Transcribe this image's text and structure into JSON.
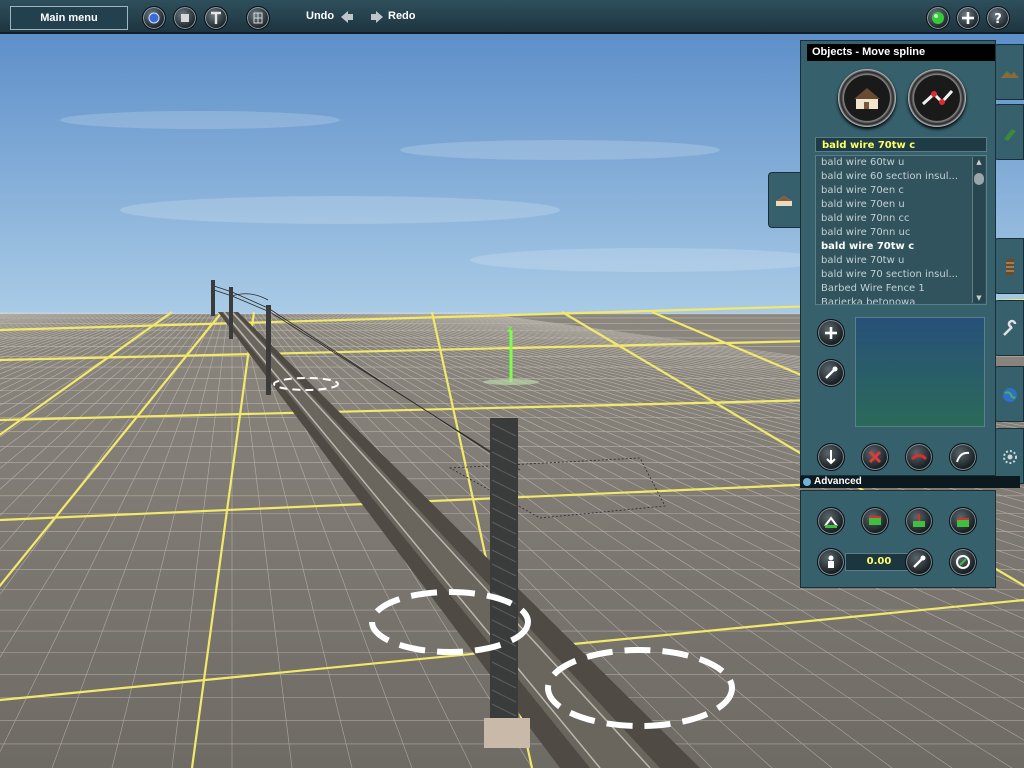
{
  "toolbar": {
    "main_menu_label": "Main menu",
    "undo_label": "Undo",
    "redo_label": "Redo",
    "icons": [
      "globe-icon",
      "stop-icon",
      "tools-icon",
      "grid-icon",
      "status-light-icon",
      "add-icon",
      "help-icon"
    ]
  },
  "objects_panel": {
    "title": "Objects - Move spline",
    "selected": "bald wire 70tw c",
    "list": [
      "bald wire 60tw u",
      "bald wire 60 section insul...",
      "bald wire 70en c",
      "bald wire 70en u",
      "bald wire 70nn cc",
      "bald wire 70nn uc",
      "bald wire 70tw c",
      "bald wire 70tw u",
      "bald wire 70 section insul...",
      "Barbed Wire Fence 1",
      "Barierka betonowa"
    ],
    "selected_index": 6
  },
  "advanced": {
    "label": "Advanced",
    "value": "0.00"
  },
  "colors": {
    "panel": "#35606c",
    "highlight_text": "#ffff66",
    "grid_line": "#f2e86a",
    "sky_top": "#5e8fc9"
  }
}
